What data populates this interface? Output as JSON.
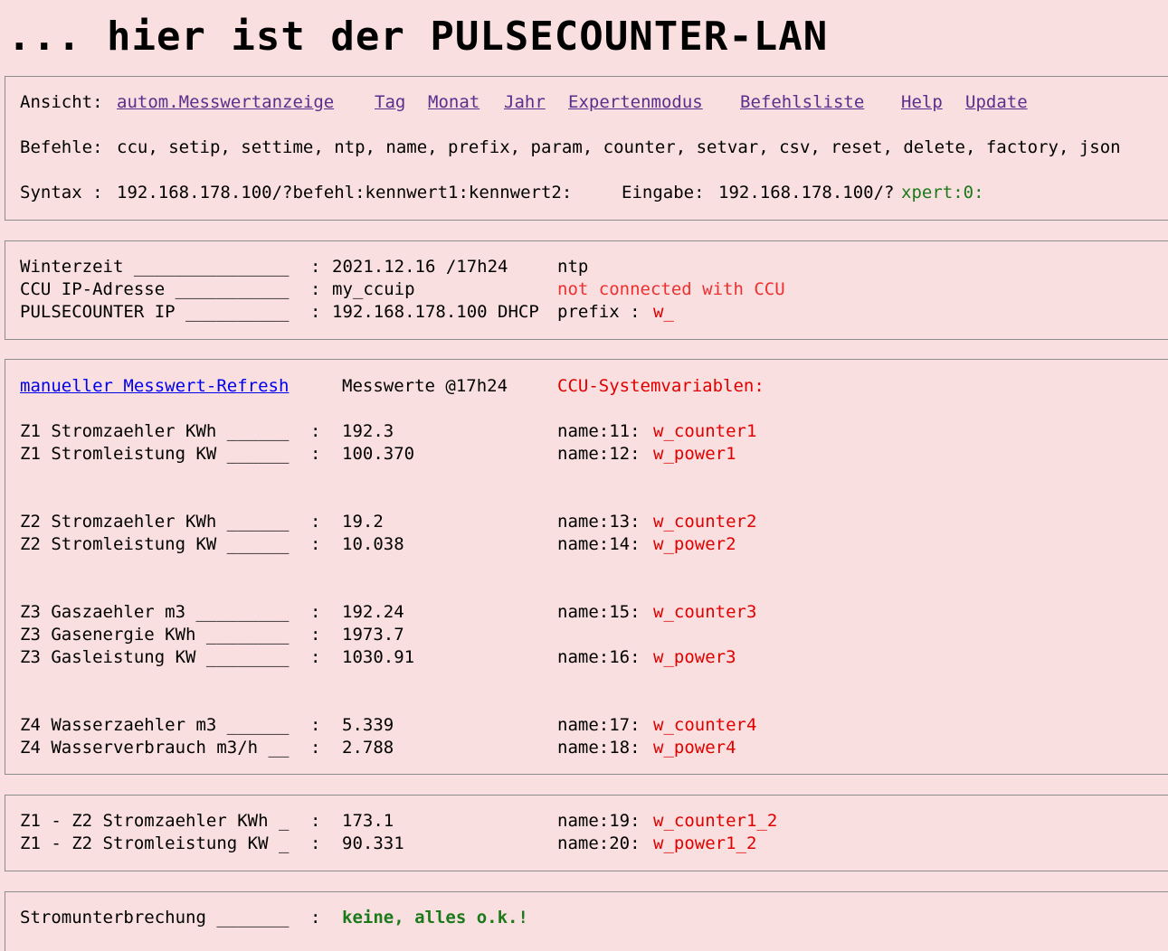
{
  "title": "... hier ist der PULSECOUNTER-LAN",
  "nav": {
    "label": "Ansicht:",
    "links": [
      "autom.Messwertanzeige",
      "Tag",
      "Monat",
      "Jahr",
      "Expertenmodus",
      "Befehlsliste",
      "Help",
      "Update"
    ]
  },
  "commands": {
    "label": "Befehle:",
    "list": "ccu, setip, settime, ntp, name, prefix, param, counter, setvar, csv, reset, delete, factory, json"
  },
  "syntax": {
    "label": "Syntax :",
    "value": "192.168.178.100/?befehl:kennwert1:kennwert2:",
    "input_label": "Eingabe:",
    "input_prefix": "192.168.178.100/?",
    "input_suffix": "xpert:0:"
  },
  "status": {
    "rows": [
      {
        "label": "Winterzeit _______________",
        "sep": ":",
        "value": "2021.12.16 /17h24",
        "extra": "ntp",
        "extra_value": ""
      },
      {
        "label": "CCU IP-Adresse ___________",
        "sep": ":",
        "value": "my_ccuip",
        "extra": "not connected with CCU",
        "extra_value": ""
      },
      {
        "label": "PULSECOUNTER IP __________",
        "sep": ":",
        "value": "192.168.178.100 DHCP",
        "extra": "prefix :",
        "extra_value": "w_"
      }
    ]
  },
  "measurements": {
    "refresh_link": "manueller Messwert-Refresh",
    "header_values": "Messwerte @17h24",
    "header_vars": "CCU-Systemvariablen:",
    "rows": [
      {
        "label": "Z1 Stromzaehler KWh ______",
        "sep": ":",
        "value": "192.3",
        "var_label": "name:11:",
        "var_value": "w_counter1"
      },
      {
        "label": "Z1 Stromleistung KW ______",
        "sep": ":",
        "value": "100.370",
        "var_label": "name:12:",
        "var_value": "w_power1"
      },
      {
        "label": "Z2 Stromzaehler KWh ______",
        "sep": ":",
        "value": "19.2",
        "var_label": "name:13:",
        "var_value": "w_counter2"
      },
      {
        "label": "Z2 Stromleistung KW ______",
        "sep": ":",
        "value": "10.038",
        "var_label": "name:14:",
        "var_value": "w_power2"
      },
      {
        "label": "Z3 Gaszaehler m3 _________",
        "sep": ":",
        "value": "192.24",
        "var_label": "name:15:",
        "var_value": "w_counter3"
      },
      {
        "label": "Z3 Gasenergie KWh ________",
        "sep": ":",
        "value": "1973.7",
        "var_label": "",
        "var_value": ""
      },
      {
        "label": "Z3 Gasleistung KW ________",
        "sep": ":",
        "value": "1030.91",
        "var_label": "name:16:",
        "var_value": "w_power3"
      },
      {
        "label": "Z4 Wasserzaehler m3 ______",
        "sep": ":",
        "value": "5.339",
        "var_label": "name:17:",
        "var_value": "w_counter4"
      },
      {
        "label": "Z4 Wasserverbrauch m3/h __",
        "sep": ":",
        "value": "2.788",
        "var_label": "name:18:",
        "var_value": "w_power4"
      }
    ]
  },
  "diff": {
    "rows": [
      {
        "label": "Z1 - Z2 Stromzaehler KWh _",
        "sep": ":",
        "value": "173.1",
        "var_label": "name:19:",
        "var_value": "w_counter1_2"
      },
      {
        "label": "Z1 - Z2 Stromleistung KW _",
        "sep": ":",
        "value": "90.331",
        "var_label": "name:20:",
        "var_value": "w_power1_2"
      }
    ]
  },
  "power_outage": {
    "label": "Stromunterbrechung _______",
    "sep": ":",
    "value": "keine, alles o.k.!"
  },
  "colors": {
    "background": "#f9dfdf",
    "link": "#5b2d8c",
    "refresh_link": "#0000ee",
    "variable": "#e00000",
    "ok": "#1a7a1a"
  }
}
